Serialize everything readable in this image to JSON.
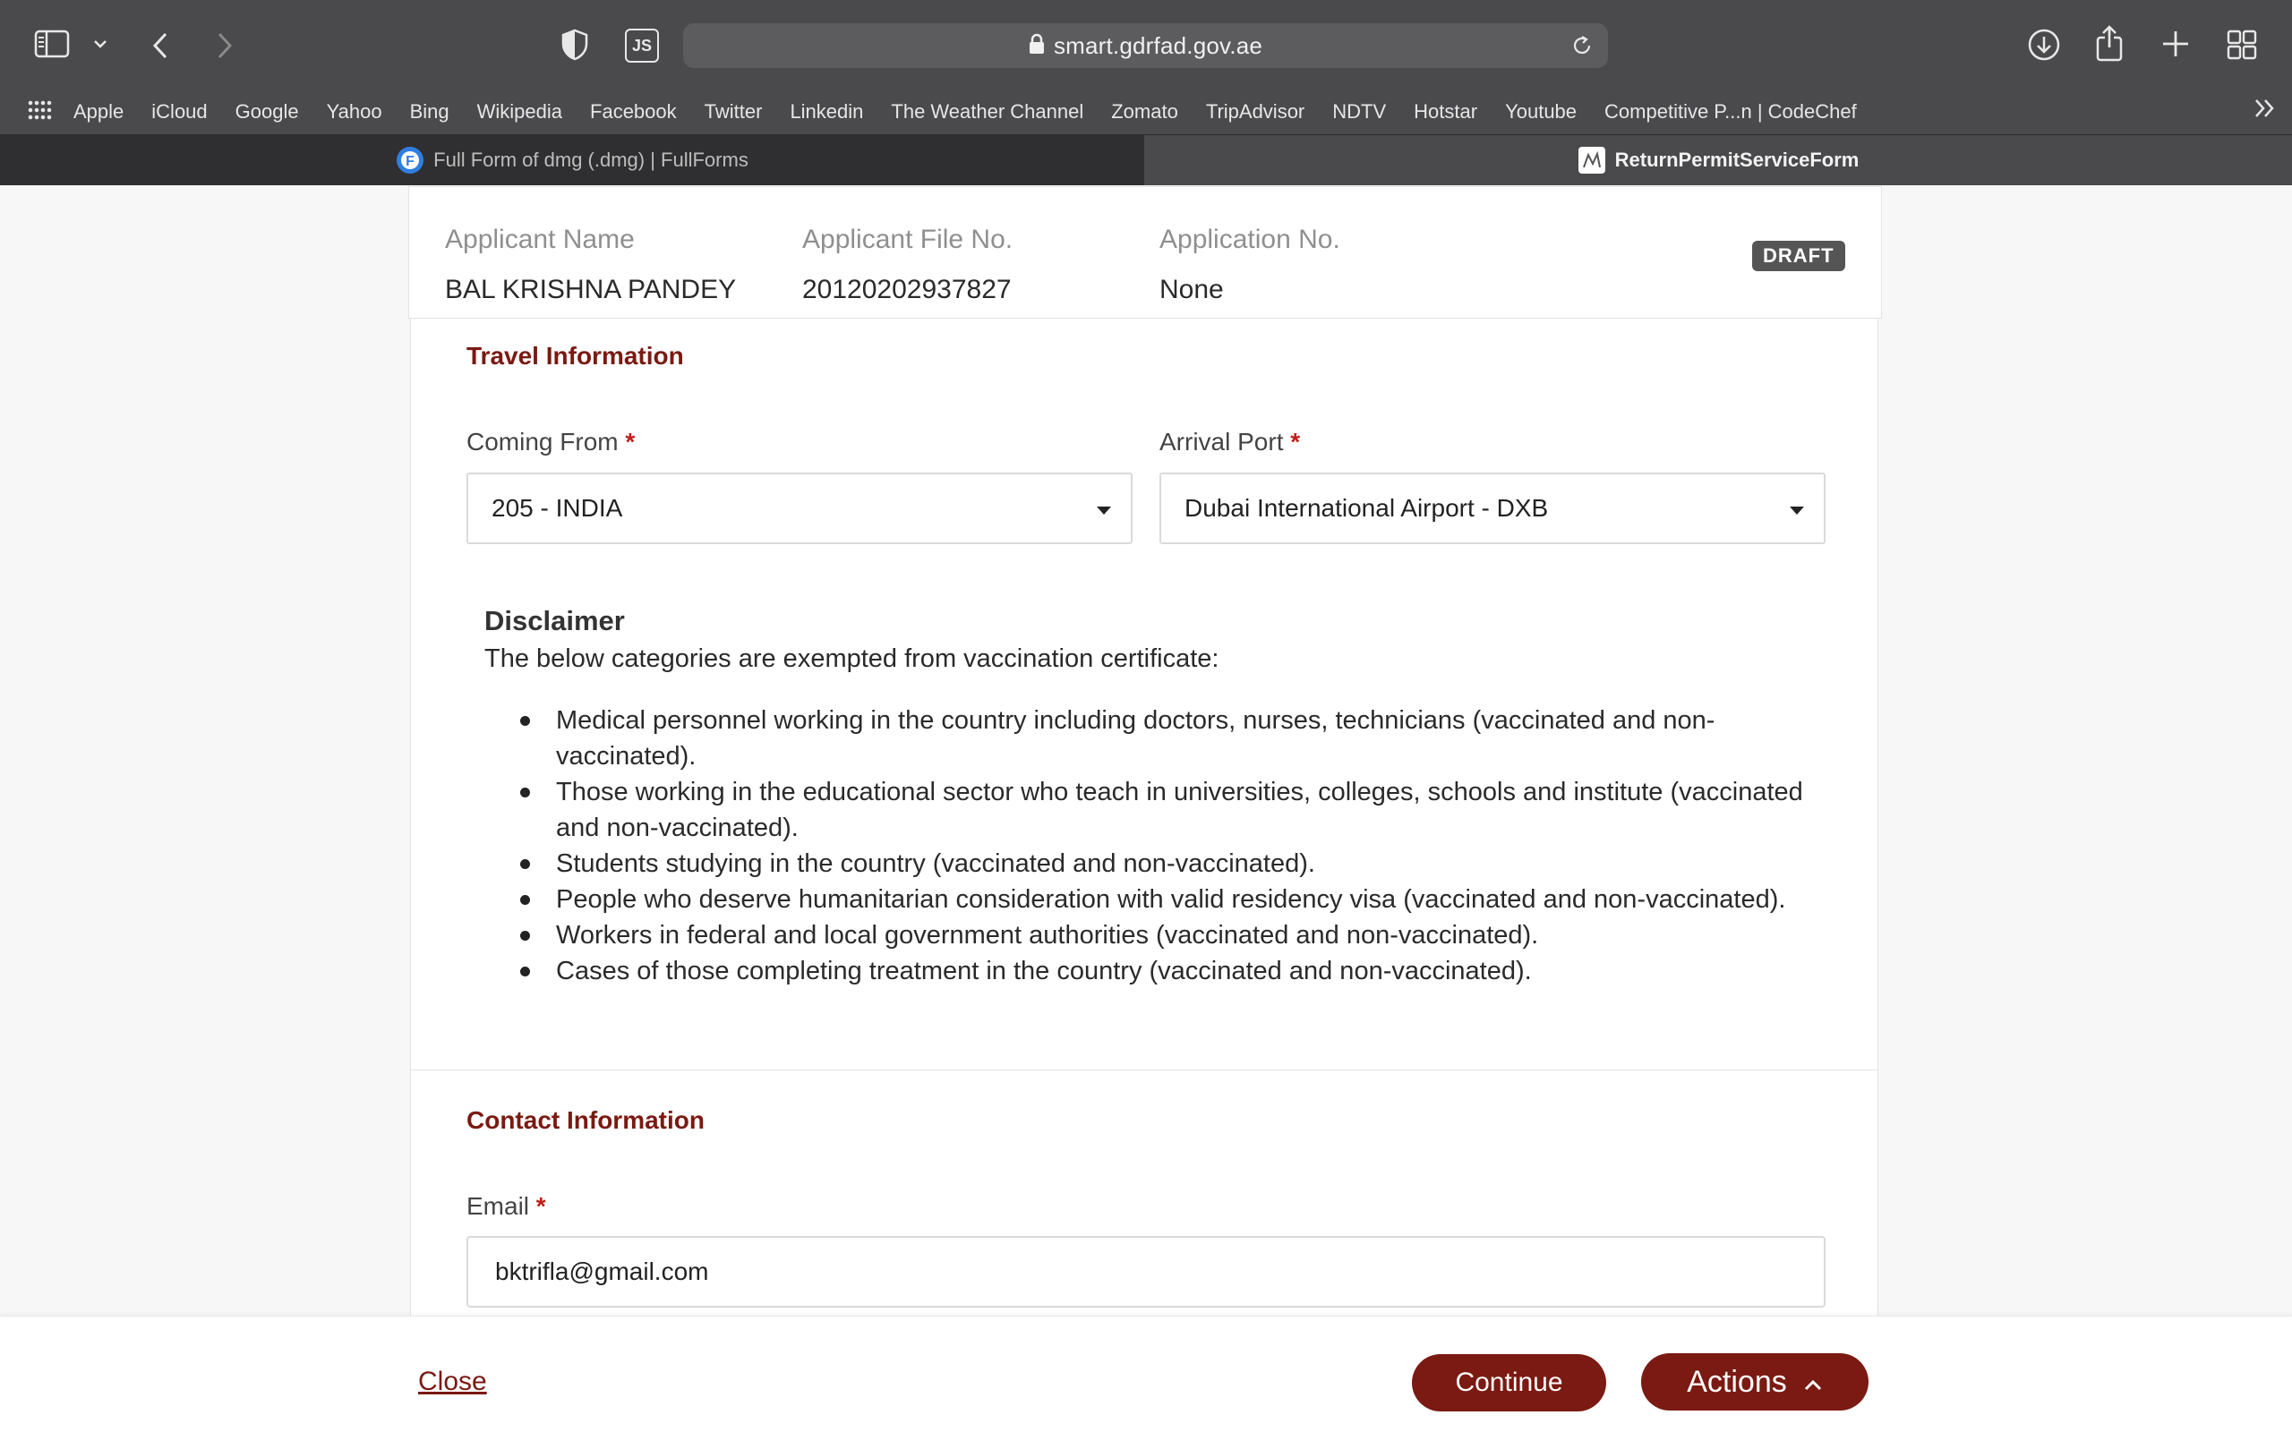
{
  "browser": {
    "url": "smart.gdrfad.gov.ae",
    "bookmarks": [
      "Apple",
      "iCloud",
      "Google",
      "Yahoo",
      "Bing",
      "Wikipedia",
      "Facebook",
      "Twitter",
      "Linkedin",
      "The Weather Channel",
      "Zomato",
      "TripAdvisor",
      "NDTV",
      "Hotstar",
      "Youtube",
      "Competitive P...n | CodeChef"
    ],
    "tabs": [
      {
        "title": "Full Form of dmg (.dmg) | FullForms",
        "active": false
      },
      {
        "title": "ReturnPermitServiceForm",
        "active": true
      }
    ],
    "js_badge": "JS"
  },
  "applicant": {
    "name_label": "Applicant Name",
    "name_value": "BAL KRISHNA PANDEY",
    "file_label": "Applicant File No.",
    "file_value": "20120202937827",
    "appno_label": "Application No.",
    "appno_value": "None",
    "status": "DRAFT"
  },
  "travel": {
    "title": "Travel Information",
    "coming_from_label": "Coming From",
    "coming_from_value": "205 - INDIA",
    "arrival_port_label": "Arrival Port",
    "arrival_port_value": "Dubai International Airport - DXB",
    "required_mark": "*"
  },
  "disclaimer": {
    "title": "Disclaimer",
    "intro": "The below categories are exempted from vaccination certificate:",
    "items": [
      "Medical personnel working in the country including doctors, nurses, technicians (vaccinated and non-vaccinated).",
      "Those working in the educational sector who teach in universities, colleges, schools and institute (vaccinated and non-vaccinated).",
      "Students studying in the country (vaccinated and non-vaccinated).",
      "People who deserve humanitarian consideration with valid residency visa (vaccinated and non-vaccinated).",
      "Workers in federal and local government authorities (vaccinated and non-vaccinated).",
      "Cases of those completing treatment in the country (vaccinated and non-vaccinated)."
    ]
  },
  "contact": {
    "title": "Contact Information",
    "email_label": "Email",
    "email_value": "bktrifla@gmail.com"
  },
  "footer": {
    "close_label": "Close",
    "continue_label": "Continue",
    "actions_label": "Actions"
  },
  "colors": {
    "brand": "#7a1a12",
    "chrome": "#4a4a4c",
    "required": "#c0201a"
  },
  "icons": [
    "sidebar-icon",
    "chevron-down-icon",
    "back-icon",
    "forward-icon",
    "shield-icon",
    "js-icon",
    "lock-icon",
    "reload-icon",
    "download-icon",
    "share-icon",
    "plus-icon",
    "tab-overview-icon",
    "grid-icon",
    "more-bookmarks-icon",
    "caret-down-icon",
    "chevron-up-icon"
  ]
}
